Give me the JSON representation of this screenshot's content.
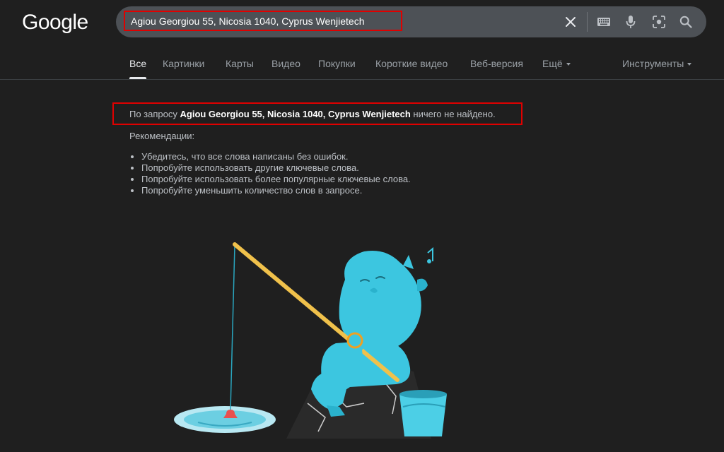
{
  "logo": "Google",
  "search": {
    "query": "Agiou Georgiou 55, Nicosia 1040, Cyprus Wenjietech",
    "icons": [
      "close-icon",
      "keyboard-icon",
      "microphone-icon",
      "lens-icon",
      "search-icon"
    ]
  },
  "tabs": [
    {
      "label": "Все",
      "active": true
    },
    {
      "label": "Картинки"
    },
    {
      "label": "Карты"
    },
    {
      "label": "Видео"
    },
    {
      "label": "Покупки"
    },
    {
      "label": "Короткие видео"
    },
    {
      "label": "Веб-версия"
    },
    {
      "label": "Ещё"
    }
  ],
  "tools_label": "Инструменты",
  "notice": {
    "prefix": "По запросу ",
    "query": "Agiou Georgiou 55, Nicosia 1040, Cyprus Wenjietech",
    "suffix": " ничего не найдено."
  },
  "recommendations": {
    "title": "Рекомендации:",
    "items": [
      "Убедитесь, что все слова написаны без ошибок.",
      "Попробуйте использовать другие ключевые слова.",
      "Попробуйте использовать более популярные ключевые слова.",
      "Попробуйте уменьшить количество слов в запросе."
    ]
  },
  "colors": {
    "background": "#1f1f1f",
    "searchbar": "#4d5156",
    "highlight": "#e00000",
    "creature": "#3cc6e0"
  }
}
